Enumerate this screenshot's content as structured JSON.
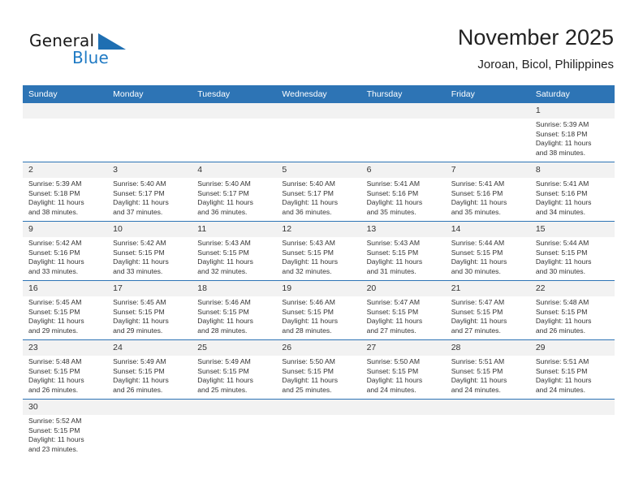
{
  "brand": {
    "name_top": "General",
    "name_bottom": "Blue",
    "flag_icon": "triangle-flag-icon",
    "color_blue": "#1f7ac4"
  },
  "header": {
    "title": "November 2025",
    "subtitle": "Joroan, Bicol, Philippines"
  },
  "theme": {
    "header_bg": "#2d74b5",
    "daynum_bg": "#f2f2f2",
    "rule": "#2d74b5"
  },
  "weekdays": [
    "Sunday",
    "Monday",
    "Tuesday",
    "Wednesday",
    "Thursday",
    "Friday",
    "Saturday"
  ],
  "labels": {
    "sunrise": "Sunrise:",
    "sunset": "Sunset:",
    "daylight": "Daylight:"
  },
  "weeks": [
    [
      {
        "day": "",
        "blank": true
      },
      {
        "day": "",
        "blank": true
      },
      {
        "day": "",
        "blank": true
      },
      {
        "day": "",
        "blank": true
      },
      {
        "day": "",
        "blank": true
      },
      {
        "day": "",
        "blank": true
      },
      {
        "day": "1",
        "sunrise": "Sunrise: 5:39 AM",
        "sunset": "Sunset: 5:18 PM",
        "daylight_1": "Daylight: 11 hours",
        "daylight_2": "and 38 minutes."
      }
    ],
    [
      {
        "day": "2",
        "sunrise": "Sunrise: 5:39 AM",
        "sunset": "Sunset: 5:18 PM",
        "daylight_1": "Daylight: 11 hours",
        "daylight_2": "and 38 minutes."
      },
      {
        "day": "3",
        "sunrise": "Sunrise: 5:40 AM",
        "sunset": "Sunset: 5:17 PM",
        "daylight_1": "Daylight: 11 hours",
        "daylight_2": "and 37 minutes."
      },
      {
        "day": "4",
        "sunrise": "Sunrise: 5:40 AM",
        "sunset": "Sunset: 5:17 PM",
        "daylight_1": "Daylight: 11 hours",
        "daylight_2": "and 36 minutes."
      },
      {
        "day": "5",
        "sunrise": "Sunrise: 5:40 AM",
        "sunset": "Sunset: 5:17 PM",
        "daylight_1": "Daylight: 11 hours",
        "daylight_2": "and 36 minutes."
      },
      {
        "day": "6",
        "sunrise": "Sunrise: 5:41 AM",
        "sunset": "Sunset: 5:16 PM",
        "daylight_1": "Daylight: 11 hours",
        "daylight_2": "and 35 minutes."
      },
      {
        "day": "7",
        "sunrise": "Sunrise: 5:41 AM",
        "sunset": "Sunset: 5:16 PM",
        "daylight_1": "Daylight: 11 hours",
        "daylight_2": "and 35 minutes."
      },
      {
        "day": "8",
        "sunrise": "Sunrise: 5:41 AM",
        "sunset": "Sunset: 5:16 PM",
        "daylight_1": "Daylight: 11 hours",
        "daylight_2": "and 34 minutes."
      }
    ],
    [
      {
        "day": "9",
        "sunrise": "Sunrise: 5:42 AM",
        "sunset": "Sunset: 5:16 PM",
        "daylight_1": "Daylight: 11 hours",
        "daylight_2": "and 33 minutes."
      },
      {
        "day": "10",
        "sunrise": "Sunrise: 5:42 AM",
        "sunset": "Sunset: 5:15 PM",
        "daylight_1": "Daylight: 11 hours",
        "daylight_2": "and 33 minutes."
      },
      {
        "day": "11",
        "sunrise": "Sunrise: 5:43 AM",
        "sunset": "Sunset: 5:15 PM",
        "daylight_1": "Daylight: 11 hours",
        "daylight_2": "and 32 minutes."
      },
      {
        "day": "12",
        "sunrise": "Sunrise: 5:43 AM",
        "sunset": "Sunset: 5:15 PM",
        "daylight_1": "Daylight: 11 hours",
        "daylight_2": "and 32 minutes."
      },
      {
        "day": "13",
        "sunrise": "Sunrise: 5:43 AM",
        "sunset": "Sunset: 5:15 PM",
        "daylight_1": "Daylight: 11 hours",
        "daylight_2": "and 31 minutes."
      },
      {
        "day": "14",
        "sunrise": "Sunrise: 5:44 AM",
        "sunset": "Sunset: 5:15 PM",
        "daylight_1": "Daylight: 11 hours",
        "daylight_2": "and 30 minutes."
      },
      {
        "day": "15",
        "sunrise": "Sunrise: 5:44 AM",
        "sunset": "Sunset: 5:15 PM",
        "daylight_1": "Daylight: 11 hours",
        "daylight_2": "and 30 minutes."
      }
    ],
    [
      {
        "day": "16",
        "sunrise": "Sunrise: 5:45 AM",
        "sunset": "Sunset: 5:15 PM",
        "daylight_1": "Daylight: 11 hours",
        "daylight_2": "and 29 minutes."
      },
      {
        "day": "17",
        "sunrise": "Sunrise: 5:45 AM",
        "sunset": "Sunset: 5:15 PM",
        "daylight_1": "Daylight: 11 hours",
        "daylight_2": "and 29 minutes."
      },
      {
        "day": "18",
        "sunrise": "Sunrise: 5:46 AM",
        "sunset": "Sunset: 5:15 PM",
        "daylight_1": "Daylight: 11 hours",
        "daylight_2": "and 28 minutes."
      },
      {
        "day": "19",
        "sunrise": "Sunrise: 5:46 AM",
        "sunset": "Sunset: 5:15 PM",
        "daylight_1": "Daylight: 11 hours",
        "daylight_2": "and 28 minutes."
      },
      {
        "day": "20",
        "sunrise": "Sunrise: 5:47 AM",
        "sunset": "Sunset: 5:15 PM",
        "daylight_1": "Daylight: 11 hours",
        "daylight_2": "and 27 minutes."
      },
      {
        "day": "21",
        "sunrise": "Sunrise: 5:47 AM",
        "sunset": "Sunset: 5:15 PM",
        "daylight_1": "Daylight: 11 hours",
        "daylight_2": "and 27 minutes."
      },
      {
        "day": "22",
        "sunrise": "Sunrise: 5:48 AM",
        "sunset": "Sunset: 5:15 PM",
        "daylight_1": "Daylight: 11 hours",
        "daylight_2": "and 26 minutes."
      }
    ],
    [
      {
        "day": "23",
        "sunrise": "Sunrise: 5:48 AM",
        "sunset": "Sunset: 5:15 PM",
        "daylight_1": "Daylight: 11 hours",
        "daylight_2": "and 26 minutes."
      },
      {
        "day": "24",
        "sunrise": "Sunrise: 5:49 AM",
        "sunset": "Sunset: 5:15 PM",
        "daylight_1": "Daylight: 11 hours",
        "daylight_2": "and 26 minutes."
      },
      {
        "day": "25",
        "sunrise": "Sunrise: 5:49 AM",
        "sunset": "Sunset: 5:15 PM",
        "daylight_1": "Daylight: 11 hours",
        "daylight_2": "and 25 minutes."
      },
      {
        "day": "26",
        "sunrise": "Sunrise: 5:50 AM",
        "sunset": "Sunset: 5:15 PM",
        "daylight_1": "Daylight: 11 hours",
        "daylight_2": "and 25 minutes."
      },
      {
        "day": "27",
        "sunrise": "Sunrise: 5:50 AM",
        "sunset": "Sunset: 5:15 PM",
        "daylight_1": "Daylight: 11 hours",
        "daylight_2": "and 24 minutes."
      },
      {
        "day": "28",
        "sunrise": "Sunrise: 5:51 AM",
        "sunset": "Sunset: 5:15 PM",
        "daylight_1": "Daylight: 11 hours",
        "daylight_2": "and 24 minutes."
      },
      {
        "day": "29",
        "sunrise": "Sunrise: 5:51 AM",
        "sunset": "Sunset: 5:15 PM",
        "daylight_1": "Daylight: 11 hours",
        "daylight_2": "and 24 minutes."
      }
    ],
    [
      {
        "day": "30",
        "sunrise": "Sunrise: 5:52 AM",
        "sunset": "Sunset: 5:15 PM",
        "daylight_1": "Daylight: 11 hours",
        "daylight_2": "and 23 minutes."
      },
      {
        "day": "",
        "blank": true
      },
      {
        "day": "",
        "blank": true
      },
      {
        "day": "",
        "blank": true
      },
      {
        "day": "",
        "blank": true
      },
      {
        "day": "",
        "blank": true
      },
      {
        "day": "",
        "blank": true
      }
    ]
  ]
}
